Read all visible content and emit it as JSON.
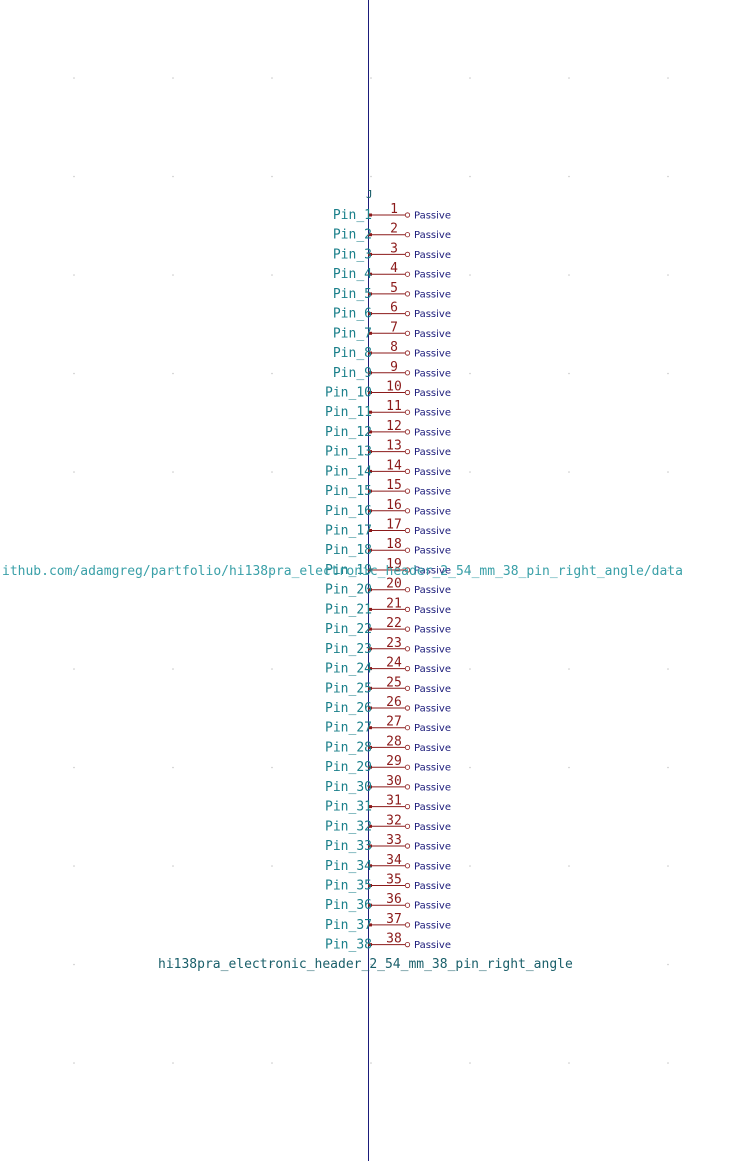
{
  "reference": "J",
  "part_name": "hi138pra_electronic_header_2_54_mm_38_pin_right_angle",
  "datasheet_url_visible": "ithub.com/adamgreg/partfolio/hi138pra_electronic_header_2_54_mm_38_pin_right_angle/data",
  "pin_type_label": "Passive",
  "colors": {
    "axis_line": "#1b1b7a",
    "pin_line": "#8b1a1a",
    "pin_name": "#1a7f8a",
    "pin_number": "#8b1a1a",
    "pin_type": "#1b1b7a",
    "grid_dot": "#c8c8c8"
  },
  "pins": [
    {
      "number": "1",
      "name": "Pin_1"
    },
    {
      "number": "2",
      "name": "Pin_2"
    },
    {
      "number": "3",
      "name": "Pin_3"
    },
    {
      "number": "4",
      "name": "Pin_4"
    },
    {
      "number": "5",
      "name": "Pin_5"
    },
    {
      "number": "6",
      "name": "Pin_6"
    },
    {
      "number": "7",
      "name": "Pin_7"
    },
    {
      "number": "8",
      "name": "Pin_8"
    },
    {
      "number": "9",
      "name": "Pin_9"
    },
    {
      "number": "10",
      "name": "Pin_10"
    },
    {
      "number": "11",
      "name": "Pin_11"
    },
    {
      "number": "12",
      "name": "Pin_12"
    },
    {
      "number": "13",
      "name": "Pin_13"
    },
    {
      "number": "14",
      "name": "Pin_14"
    },
    {
      "number": "15",
      "name": "Pin_15"
    },
    {
      "number": "16",
      "name": "Pin_16"
    },
    {
      "number": "17",
      "name": "Pin_17"
    },
    {
      "number": "18",
      "name": "Pin_18"
    },
    {
      "number": "19",
      "name": "Pin_19"
    },
    {
      "number": "20",
      "name": "Pin_20"
    },
    {
      "number": "21",
      "name": "Pin_21"
    },
    {
      "number": "22",
      "name": "Pin_22"
    },
    {
      "number": "23",
      "name": "Pin_23"
    },
    {
      "number": "24",
      "name": "Pin_24"
    },
    {
      "number": "25",
      "name": "Pin_25"
    },
    {
      "number": "26",
      "name": "Pin_26"
    },
    {
      "number": "27",
      "name": "Pin_27"
    },
    {
      "number": "28",
      "name": "Pin_28"
    },
    {
      "number": "29",
      "name": "Pin_29"
    },
    {
      "number": "30",
      "name": "Pin_30"
    },
    {
      "number": "31",
      "name": "Pin_31"
    },
    {
      "number": "32",
      "name": "Pin_32"
    },
    {
      "number": "33",
      "name": "Pin_33"
    },
    {
      "number": "34",
      "name": "Pin_34"
    },
    {
      "number": "35",
      "name": "Pin_35"
    },
    {
      "number": "36",
      "name": "Pin_36"
    },
    {
      "number": "37",
      "name": "Pin_37"
    },
    {
      "number": "38",
      "name": "Pin_38"
    }
  ]
}
